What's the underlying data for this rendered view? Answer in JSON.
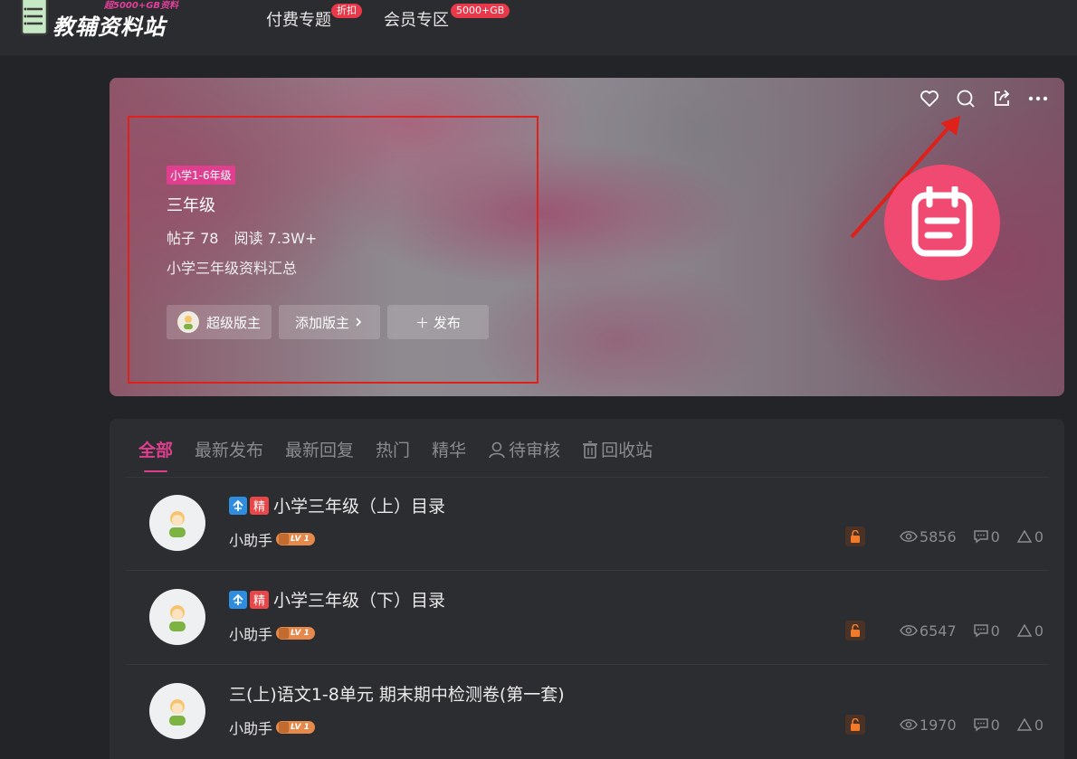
{
  "header": {
    "logo_text": "教辅资料站",
    "logo_sub": "超5000+GB资料",
    "nav": [
      {
        "label": "付费专题",
        "badge": "折扣"
      },
      {
        "label": "会员专区",
        "badge": "5000+GB"
      }
    ]
  },
  "forum": {
    "tag": "小学1-6年级",
    "title": "三年级",
    "posts_label": "帖子 78",
    "reads_label": "阅读 7.3W+",
    "description": "小学三年级资料汇总",
    "moderator_label": "超级版主",
    "add_moderator_label": "添加版主",
    "publish_label": "＋ 发布",
    "logo_color": "#f04a72"
  },
  "tabs": [
    {
      "label": "全部",
      "active": true
    },
    {
      "label": "最新发布"
    },
    {
      "label": "最新回复"
    },
    {
      "label": "热门"
    },
    {
      "label": "精华"
    },
    {
      "label": "待审核",
      "icon": "user-icon"
    },
    {
      "label": "回收站",
      "icon": "trash-icon"
    }
  ],
  "posts": [
    {
      "title": "小学三年级（上）目录",
      "pinned": true,
      "featured": true,
      "badge_jing": "精",
      "author": "小助手",
      "level": "LV 1",
      "views": "5856",
      "comments": "0",
      "likes": "0"
    },
    {
      "title": "小学三年级（下）目录",
      "pinned": true,
      "featured": true,
      "badge_jing": "精",
      "author": "小助手",
      "level": "LV 1",
      "views": "6547",
      "comments": "0",
      "likes": "0"
    },
    {
      "title": "三(上)语文1-8单元 期末期中检测卷(第一套)",
      "pinned": false,
      "featured": false,
      "author": "小助手",
      "level": "LV 1",
      "views": "1970",
      "comments": "0",
      "likes": "0"
    }
  ],
  "colors": {
    "accent": "#e03f8f",
    "annotation": "#e0201a"
  }
}
